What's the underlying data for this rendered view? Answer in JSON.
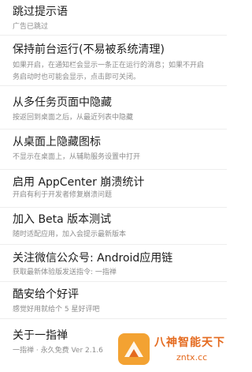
{
  "settings": [
    {
      "title": "跳过提示语",
      "subtitle": "广告已跳过"
    },
    {
      "title": "保持前台运行(不易被系统清理)",
      "subtitle": "如果开启，在通知栏会显示一条正在运行的消息；如果不开启",
      "subtitle2": "务启动时也可能会显示，点击即可关闭。"
    },
    {
      "title": "从多任务页面中隐藏",
      "subtitle": "按返回到桌面之后，从最近列表中隐藏"
    },
    {
      "title": "从桌面上隐藏图标",
      "subtitle": "不显示在桌面上，从辅助服务设置中打开"
    },
    {
      "title": "启用 AppCenter 崩溃统计",
      "subtitle": "开启有利于开发者修复崩溃问题"
    },
    {
      "title": "加入 Beta 版本测试",
      "subtitle": "随时适配应用，加入会提示最新版本"
    },
    {
      "title": "关注微信公众号: Android应用链",
      "subtitle": "获取最新体验版发送指令: 一指禅"
    },
    {
      "title": "酷安给个好评",
      "subtitle": "感觉好用就给个 5 星好评吧"
    },
    {
      "title": "关于一指禅",
      "subtitle": "一指禅 · 永久免费 Ver 2.1.6"
    }
  ],
  "watermark": {
    "line1": "八神智能天下",
    "line2": "zntx.cc",
    "accent": "#e46a1e"
  }
}
